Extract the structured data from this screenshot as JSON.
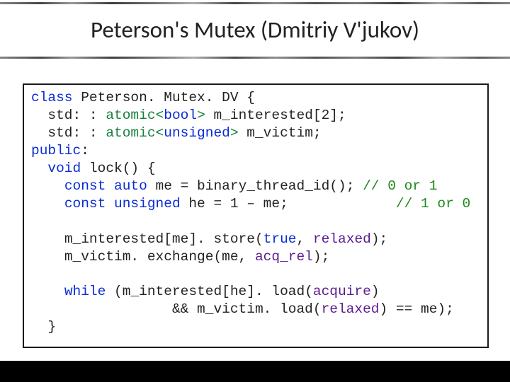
{
  "title": "Peterson's Mutex (Dmitriy V'jukov)",
  "code": {
    "t_class": "class ",
    "classname": "Peterson. Mutex. DV {",
    "l_pad": "  ",
    "t_std": "std: : ",
    "atomic": "atomic",
    "lt": "<",
    "t_bool": "bool",
    "gt": "> ",
    "m_interested": "m_interested[2];",
    "t_unsigned": "unsigned",
    "m_victim": "m_victim;",
    "t_public": "public",
    "colon": ":",
    "t_void": "void ",
    "lock": "lock() {",
    "l_pad2": "    ",
    "t_const": "const ",
    "t_auto": "auto ",
    "me_expr": "me = binary_thread_id(); ",
    "c_01": "// 0 or 1",
    "he_expr": "he = 1 – me;             ",
    "c_10": "// 1 or 0",
    "blank": "",
    "store_a": "m_interested[me]. store(",
    "t_true": "true",
    "comma": ", ",
    "ord_relaxed": "relaxed",
    "store_b": ");",
    "exch_a": "m_victim. exchange(me, ",
    "ord_acqrel": "acq_rel",
    "exch_b": ");",
    "t_while": "while ",
    "wh_a": "(m_interested[he]. load(",
    "ord_acquire": "acquire",
    "wh_b": ")",
    "wh_indent": "                 ",
    "wh_c": "&& m_victim. load(",
    "wh_d": ") == me);",
    "brace": "  }"
  }
}
